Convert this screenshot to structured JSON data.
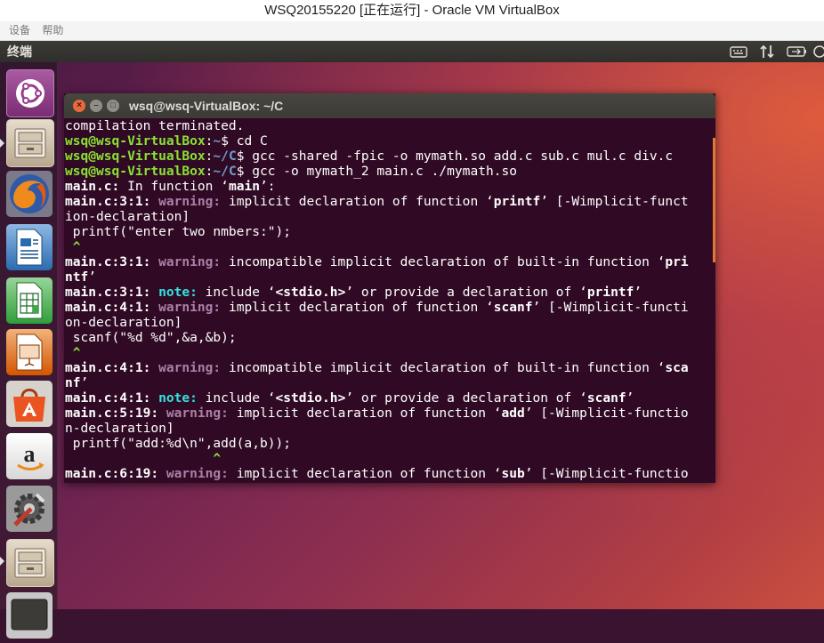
{
  "vbox": {
    "title": "WSQ20155220 [正在运行] - Oracle VM VirtualBox",
    "menu": [
      "设备",
      "帮助"
    ]
  },
  "panel": {
    "title": "终端",
    "indicators": [
      "keyboard-icon",
      "network-arrows-icon",
      "battery-icon",
      "power-gear-icon"
    ]
  },
  "launcher": {
    "items": [
      {
        "name": "ubuntu-dash-icon",
        "color": "#e95420"
      },
      {
        "name": "files-icon",
        "color": "#b7a78d"
      },
      {
        "name": "firefox-icon",
        "color": "#e66000"
      },
      {
        "name": "libreoffice-writer-icon",
        "color": "#2a6cb0"
      },
      {
        "name": "libreoffice-calc-icon",
        "color": "#2f9e3a"
      },
      {
        "name": "libreoffice-impress-icon",
        "color": "#d45500"
      },
      {
        "name": "software-center-icon",
        "color": "#e95420"
      },
      {
        "name": "amazon-icon",
        "color": "#f0f0f0"
      },
      {
        "name": "system-settings-icon",
        "color": "#6a6a6a"
      },
      {
        "name": "files-icon",
        "color": "#b7a78d"
      },
      {
        "name": "terminal-icon",
        "color": "#3c3b37"
      }
    ]
  },
  "terminal": {
    "title": "wsq@wsq-VirtualBox: ~/C",
    "lines": [
      {
        "segments": [
          {
            "t": "compilation terminated.",
            "c": ""
          }
        ]
      },
      {
        "segments": [
          {
            "t": "wsq@wsq-VirtualBox",
            "c": "prompt-user"
          },
          {
            "t": ":",
            "c": ""
          },
          {
            "t": "~",
            "c": "prompt-path"
          },
          {
            "t": "$ cd C",
            "c": ""
          }
        ]
      },
      {
        "segments": [
          {
            "t": "wsq@wsq-VirtualBox",
            "c": "prompt-user"
          },
          {
            "t": ":",
            "c": ""
          },
          {
            "t": "~/C",
            "c": "prompt-path"
          },
          {
            "t": "$ gcc -shared -fpic -o mymath.so add.c sub.c mul.c div.c",
            "c": ""
          }
        ]
      },
      {
        "segments": [
          {
            "t": "wsq@wsq-VirtualBox",
            "c": "prompt-user"
          },
          {
            "t": ":",
            "c": ""
          },
          {
            "t": "~/C",
            "c": "prompt-path"
          },
          {
            "t": "$ gcc -o mymath_2 main.c ./mymath.so",
            "c": ""
          }
        ]
      },
      {
        "segments": [
          {
            "t": "main.c:",
            "c": "b"
          },
          {
            "t": " In function ‘",
            "c": ""
          },
          {
            "t": "main",
            "c": "b"
          },
          {
            "t": "’:",
            "c": ""
          }
        ]
      },
      {
        "segments": [
          {
            "t": "main.c:3:1:",
            "c": "b"
          },
          {
            "t": " ",
            "c": ""
          },
          {
            "t": "warning:",
            "c": "warn"
          },
          {
            "t": " implicit declaration of function ‘",
            "c": ""
          },
          {
            "t": "printf",
            "c": "b"
          },
          {
            "t": "’ [-Wimplicit-funct",
            "c": ""
          }
        ]
      },
      {
        "segments": [
          {
            "t": "ion-declaration]",
            "c": ""
          }
        ]
      },
      {
        "segments": [
          {
            "t": " printf(\"enter two nmbers:\");",
            "c": ""
          }
        ]
      },
      {
        "segments": [
          {
            "t": " ^",
            "c": "caret"
          }
        ]
      },
      {
        "segments": [
          {
            "t": "main.c:3:1:",
            "c": "b"
          },
          {
            "t": " ",
            "c": ""
          },
          {
            "t": "warning:",
            "c": "warn"
          },
          {
            "t": " incompatible implicit declaration of built-in function ‘",
            "c": ""
          },
          {
            "t": "pri",
            "c": "b"
          }
        ]
      },
      {
        "segments": [
          {
            "t": "ntf",
            "c": "b"
          },
          {
            "t": "’",
            "c": ""
          }
        ]
      },
      {
        "segments": [
          {
            "t": "main.c:3:1:",
            "c": "b"
          },
          {
            "t": " ",
            "c": ""
          },
          {
            "t": "note:",
            "c": "note"
          },
          {
            "t": " include ‘",
            "c": ""
          },
          {
            "t": "<stdio.h>",
            "c": "b"
          },
          {
            "t": "’ or provide a declaration of ‘",
            "c": ""
          },
          {
            "t": "printf",
            "c": "b"
          },
          {
            "t": "’",
            "c": ""
          }
        ]
      },
      {
        "segments": [
          {
            "t": "main.c:4:1:",
            "c": "b"
          },
          {
            "t": " ",
            "c": ""
          },
          {
            "t": "warning:",
            "c": "warn"
          },
          {
            "t": " implicit declaration of function ‘",
            "c": ""
          },
          {
            "t": "scanf",
            "c": "b"
          },
          {
            "t": "’ [-Wimplicit-functi",
            "c": ""
          }
        ]
      },
      {
        "segments": [
          {
            "t": "on-declaration]",
            "c": ""
          }
        ]
      },
      {
        "segments": [
          {
            "t": " scanf(\"%d %d\",&a,&b);",
            "c": ""
          }
        ]
      },
      {
        "segments": [
          {
            "t": " ^",
            "c": "caret"
          }
        ]
      },
      {
        "segments": [
          {
            "t": "main.c:4:1:",
            "c": "b"
          },
          {
            "t": " ",
            "c": ""
          },
          {
            "t": "warning:",
            "c": "warn"
          },
          {
            "t": " incompatible implicit declaration of built-in function ‘",
            "c": ""
          },
          {
            "t": "sca",
            "c": "b"
          }
        ]
      },
      {
        "segments": [
          {
            "t": "nf",
            "c": "b"
          },
          {
            "t": "’",
            "c": ""
          }
        ]
      },
      {
        "segments": [
          {
            "t": "main.c:4:1:",
            "c": "b"
          },
          {
            "t": " ",
            "c": ""
          },
          {
            "t": "note:",
            "c": "note"
          },
          {
            "t": " include ‘",
            "c": ""
          },
          {
            "t": "<stdio.h>",
            "c": "b"
          },
          {
            "t": "’ or provide a declaration of ‘",
            "c": ""
          },
          {
            "t": "scanf",
            "c": "b"
          },
          {
            "t": "’",
            "c": ""
          }
        ]
      },
      {
        "segments": [
          {
            "t": "main.c:5:19:",
            "c": "b"
          },
          {
            "t": " ",
            "c": ""
          },
          {
            "t": "warning:",
            "c": "warn"
          },
          {
            "t": " implicit declaration of function ‘",
            "c": ""
          },
          {
            "t": "add",
            "c": "b"
          },
          {
            "t": "’ [-Wimplicit-functio",
            "c": ""
          }
        ]
      },
      {
        "segments": [
          {
            "t": "n-declaration]",
            "c": ""
          }
        ]
      },
      {
        "segments": [
          {
            "t": " printf(\"add:%d\\n\",add(a,b));",
            "c": ""
          }
        ]
      },
      {
        "segments": [
          {
            "t": "                   ^",
            "c": "caret"
          }
        ]
      },
      {
        "segments": [
          {
            "t": "main.c:6:19:",
            "c": "b"
          },
          {
            "t": " ",
            "c": ""
          },
          {
            "t": "warning:",
            "c": "warn"
          },
          {
            "t": " implicit declaration of function ‘",
            "c": ""
          },
          {
            "t": "sub",
            "c": "b"
          },
          {
            "t": "’ [-Wimplicit-functio",
            "c": ""
          }
        ]
      }
    ]
  }
}
